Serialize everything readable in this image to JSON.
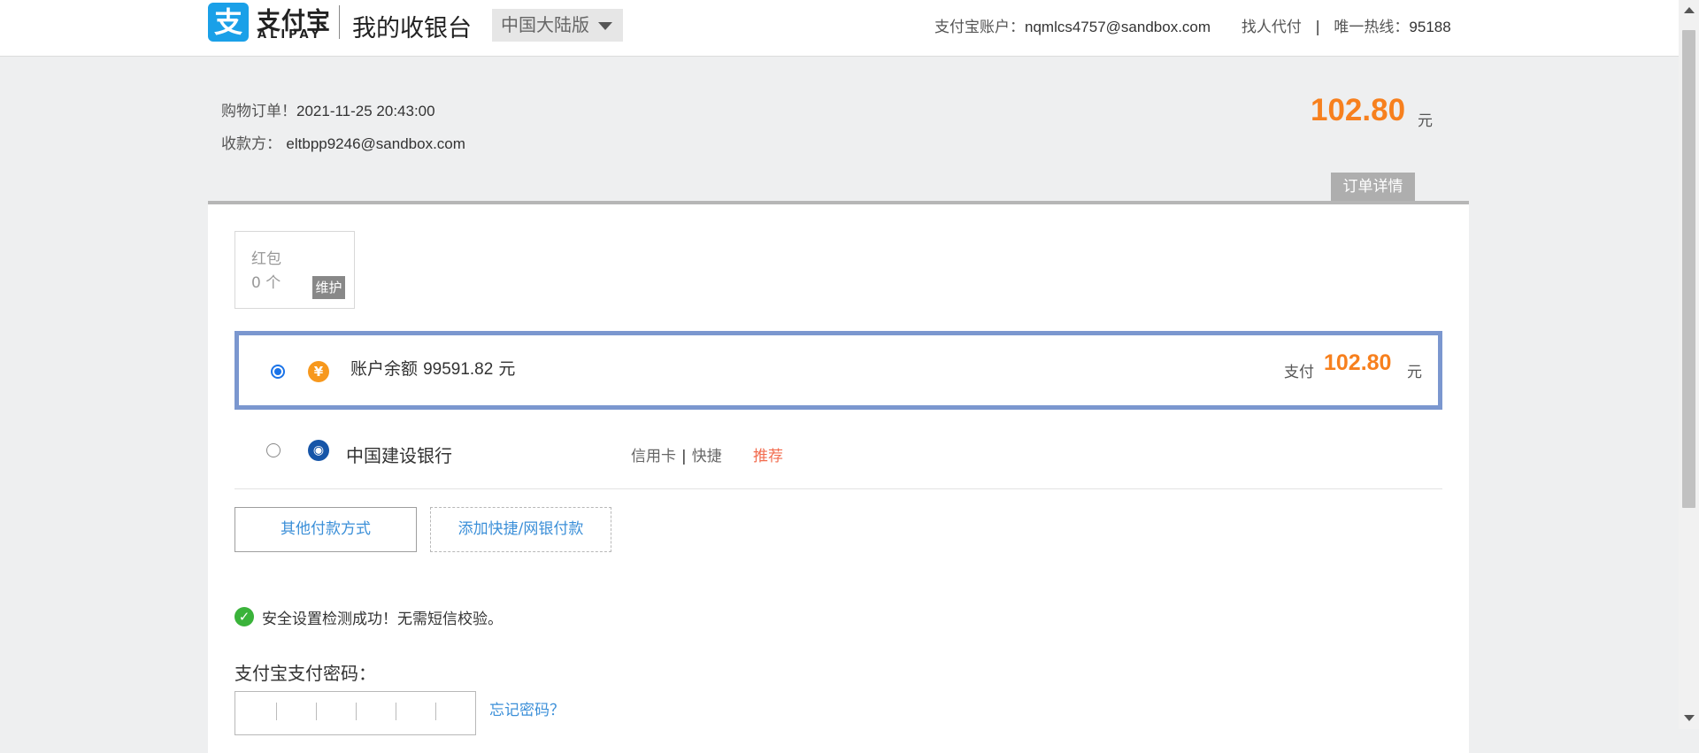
{
  "header": {
    "logo_glyph": "支",
    "logo_cn": "支付宝",
    "logo_en": "ALIPAY",
    "title": "我的收银台",
    "region": "中国大陆版",
    "account_label": "支付宝账户：",
    "account_value": "nqmlcs4757@sandbox.com",
    "agent_pay": "找人代付",
    "hotline_label": "唯一热线：",
    "hotline_value": "95188"
  },
  "order": {
    "order_label": "购物订单！",
    "order_time": "2021-11-25 20:43:00",
    "payee_label": "收款方：",
    "payee_value": "eltbpp9246@sandbox.com",
    "total_amount": "102.80",
    "total_unit": "元",
    "detail_button": "订单详情"
  },
  "hongbao": {
    "label": "红包",
    "count": "0 个",
    "status": "维护"
  },
  "payment_methods": {
    "balance": {
      "icon": "yuan-icon",
      "label": "账户余额",
      "amount": "99591.82",
      "unit": "元",
      "pay_prefix": "支付",
      "pay_amount": "102.80",
      "pay_unit": "元",
      "selected": true
    },
    "bank": {
      "icon": "ccb-bank-icon",
      "name": "中国建设银行",
      "card_type": "信用卡",
      "card_mode": "快捷",
      "tag": "推荐",
      "selected": false
    }
  },
  "actions": {
    "other_methods": "其他付款方式",
    "add_quick": "添加快捷/网银付款"
  },
  "security": {
    "message": "安全设置检测成功！无需短信校验。",
    "password_label": "支付宝支付密码：",
    "forgot_link": "忘记密码？"
  },
  "colors": {
    "accent_orange": "#f7801e",
    "link_blue": "#3b8fd8",
    "selected_border": "#7b97cf",
    "alipay_blue": "#1aa0e8"
  }
}
